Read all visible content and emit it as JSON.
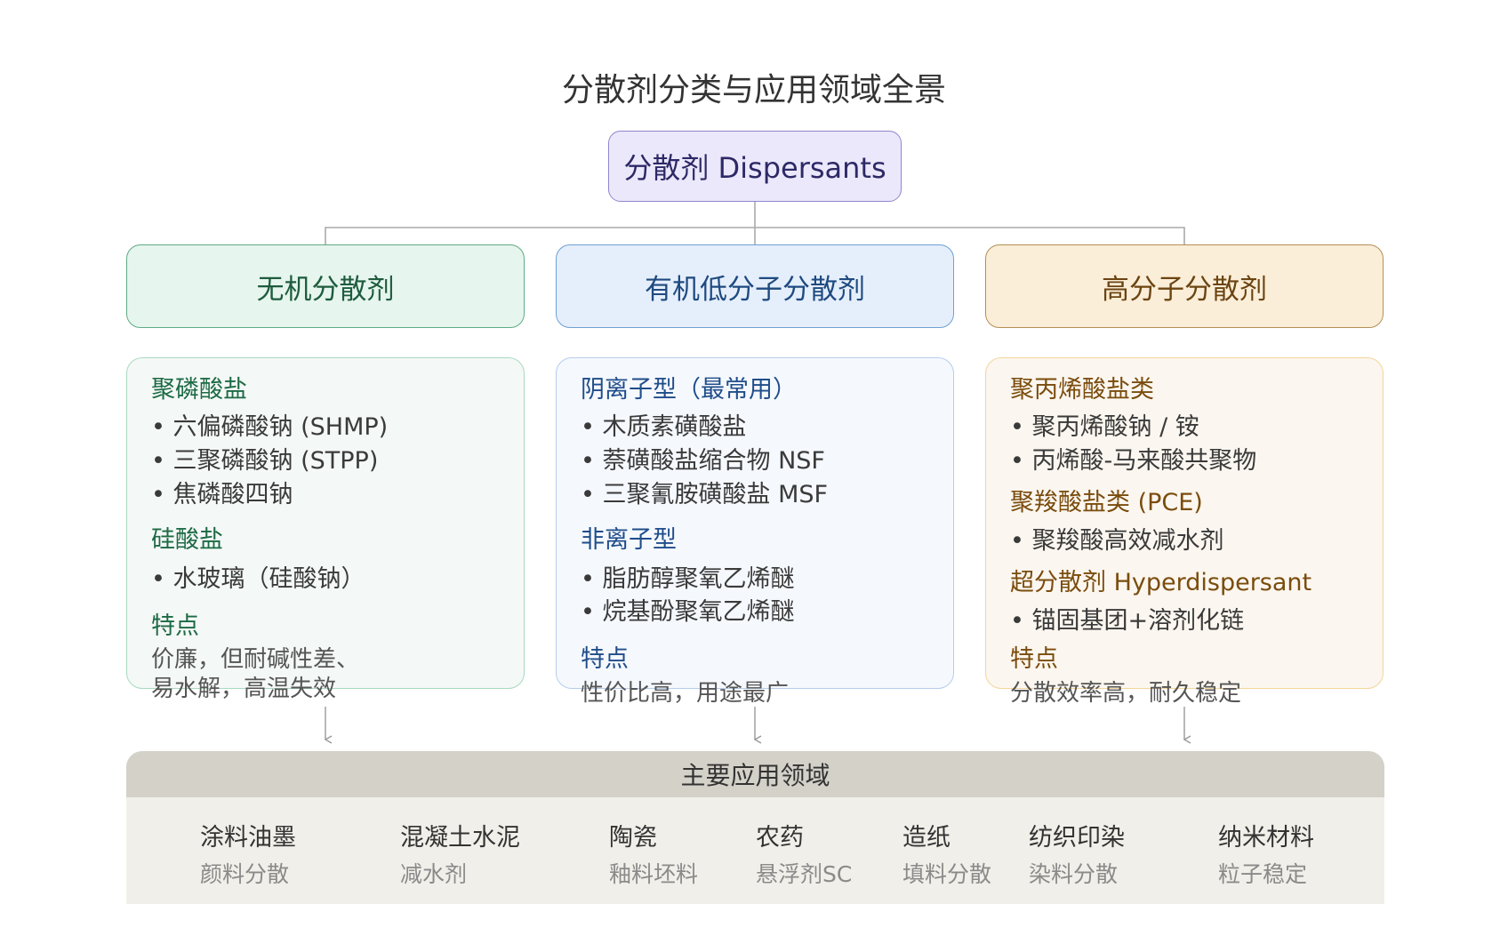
{
  "title": "分散剂分类与应用领域全景",
  "root": "分散剂 Dispersants",
  "categories": [
    {
      "label": "无机分散剂"
    },
    {
      "label": "有机低分子分散剂"
    },
    {
      "label": "高分子分散剂"
    }
  ],
  "inorganic": {
    "h1": "聚磷酸盐",
    "i1": "• 六偏磷酸钠 (SHMP)",
    "i2": "• 三聚磷酸钠 (STPP)",
    "i3": "• 焦磷酸四钠",
    "h2": "硅酸盐",
    "i4": "• 水玻璃（硅酸钠）",
    "h3": "特点",
    "f1": "价廉，但耐碱性差、",
    "f2": "易水解，高温失效"
  },
  "organic": {
    "h1": "阴离子型（最常用）",
    "i1": "• 木质素磺酸盐",
    "i2": "• 萘磺酸盐缩合物 NSF",
    "i3": "• 三聚氰胺磺酸盐 MSF",
    "h2": "非离子型",
    "i4": "• 脂肪醇聚氧乙烯醚",
    "i5": "• 烷基酚聚氧乙烯醚",
    "h3": "特点",
    "f1": "性价比高，用途最广"
  },
  "polymer": {
    "h1": "聚丙烯酸盐类",
    "i1": "• 聚丙烯酸钠 / 铵",
    "i2": "• 丙烯酸-马来酸共聚物",
    "h2": "聚羧酸盐类 (PCE)",
    "i3": "• 聚羧酸高效减水剂",
    "h3": "超分散剂 Hyperdispersant",
    "i4": "• 锚固基团+溶剂化链",
    "h4": "特点",
    "f1": "分散效率高，耐久稳定"
  },
  "applications": {
    "header": "主要应用领域",
    "items": [
      {
        "name": "涂料油墨",
        "desc": "颜料分散"
      },
      {
        "name": "混凝土水泥",
        "desc": "减水剂"
      },
      {
        "name": "陶瓷",
        "desc": "釉料坯料"
      },
      {
        "name": "农药",
        "desc": "悬浮剂SC"
      },
      {
        "name": "造纸",
        "desc": "填料分散"
      },
      {
        "name": "纺织印染",
        "desc": "染料分散"
      },
      {
        "name": "纳米材料",
        "desc": "粒子稳定"
      }
    ]
  },
  "colors": {
    "inorganic": "#5fab85",
    "organic": "#6f9fd6",
    "polymer": "#b48e55",
    "root": "#8e86cf",
    "applications_header": "#d4d1c9"
  }
}
